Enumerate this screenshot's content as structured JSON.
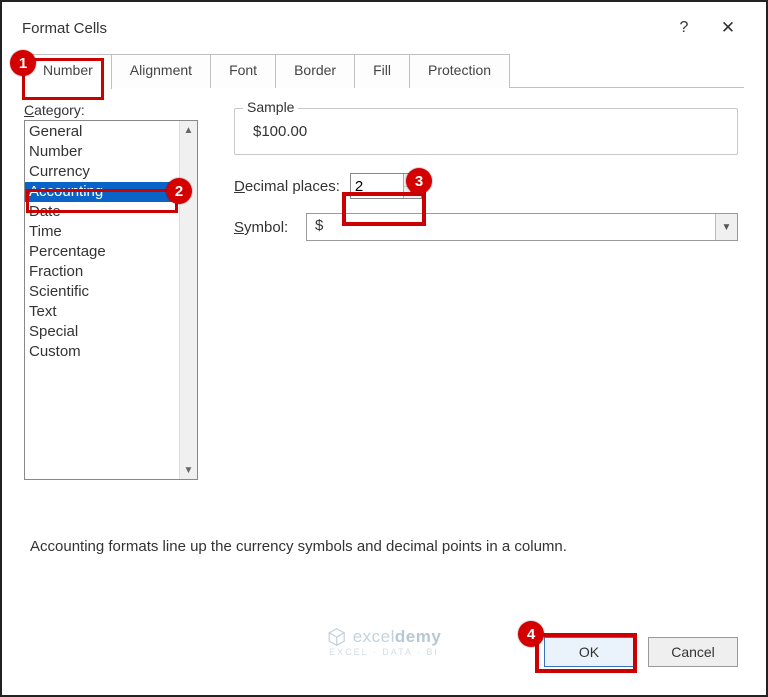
{
  "dialog": {
    "title": "Format Cells",
    "help_tooltip": "?",
    "close_tooltip": "✕"
  },
  "tabs": [
    {
      "label": "Number",
      "selected": true
    },
    {
      "label": "Alignment",
      "selected": false
    },
    {
      "label": "Font",
      "selected": false
    },
    {
      "label": "Border",
      "selected": false
    },
    {
      "label": "Fill",
      "selected": false
    },
    {
      "label": "Protection",
      "selected": false
    }
  ],
  "category": {
    "label_pre": "C",
    "label_post": "ategory:",
    "items": [
      "General",
      "Number",
      "Currency",
      "Accounting",
      "Date",
      "Time",
      "Percentage",
      "Fraction",
      "Scientific",
      "Text",
      "Special",
      "Custom"
    ],
    "selected_index": 3
  },
  "sample": {
    "legend": "Sample",
    "value": "$100.00"
  },
  "decimal": {
    "label_pre": "D",
    "label_post": "ecimal places:",
    "value": "2"
  },
  "symbol": {
    "label_pre": "S",
    "label_post": "ymbol:",
    "value": "$"
  },
  "description": "Accounting formats line up the currency symbols and decimal points in a column.",
  "buttons": {
    "ok": "OK",
    "cancel": "Cancel"
  },
  "callouts": {
    "c1": "1",
    "c2": "2",
    "c3": "3",
    "c4": "4"
  },
  "watermark": {
    "brand_prefix": "excel",
    "brand_suffix": "demy",
    "sub": "EXCEL · DATA · BI"
  }
}
